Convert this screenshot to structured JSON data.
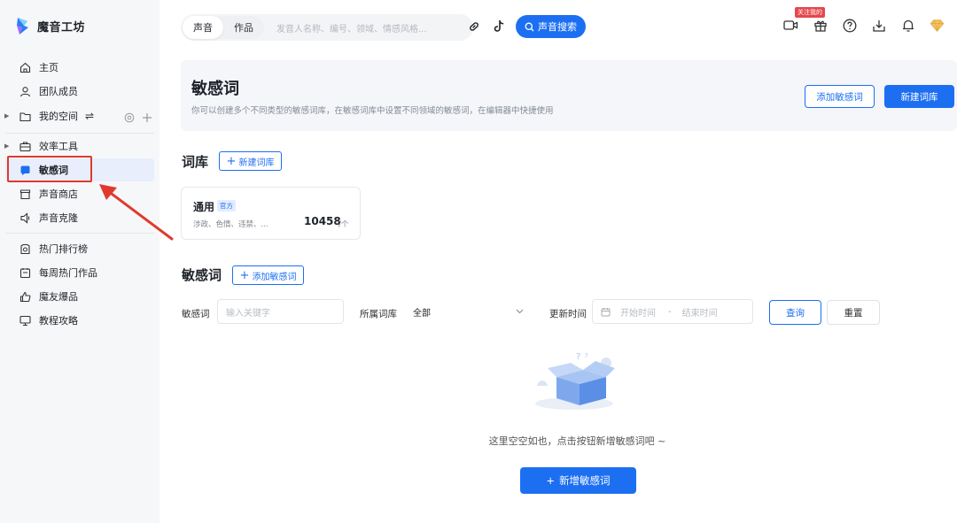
{
  "brand": {
    "name": "魔音工坊"
  },
  "sidebar": {
    "items": [
      {
        "label": "主页",
        "icon": "home-icon"
      },
      {
        "label": "团队成员",
        "icon": "user-icon"
      },
      {
        "label": "我的空间",
        "icon": "folder-icon"
      },
      {
        "label": "效率工具",
        "icon": "toolbox-icon"
      },
      {
        "label": "敏感词",
        "icon": "sensitive-word-icon"
      },
      {
        "label": "声音商店",
        "icon": "store-icon"
      },
      {
        "label": "声音克隆",
        "icon": "clone-icon"
      },
      {
        "label": "热门排行榜",
        "icon": "ranking-icon"
      },
      {
        "label": "每周热门作品",
        "icon": "calendar-icon"
      },
      {
        "label": "魔友爆品",
        "icon": "thumb-up-icon"
      },
      {
        "label": "教程攻略",
        "icon": "monitor-icon"
      }
    ],
    "active": "敏感词"
  },
  "topbar": {
    "tabs": [
      "声音",
      "作品"
    ],
    "search_placeholder": "发音人名称、编号、领域、情感风格...",
    "search_button": "声音搜索",
    "follow_tag": "关注我的"
  },
  "header": {
    "title": "敏感词",
    "description": "你可以创建多个不同类型的敏感词库，在敏感词库中设置不同领域的敏感词，在编辑器中快捷使用",
    "add_word_button": "添加敏感词",
    "new_lib_button": "新建词库"
  },
  "library": {
    "section_title": "词库",
    "new_button": "新建词库",
    "cards": [
      {
        "name": "通用",
        "badge": "官方",
        "tags": "涉政、色情、违禁、...",
        "count": "10458",
        "unit": "/个"
      }
    ]
  },
  "words": {
    "section_title": "敏感词",
    "add_button": "添加敏感词",
    "filter": {
      "word_label": "敏感词",
      "word_placeholder": "输入关键字",
      "lib_label": "所属词库",
      "lib_value": "全部",
      "time_label": "更新时间",
      "start_placeholder": "开始时间",
      "end_placeholder": "结束时间",
      "query_button": "查询",
      "reset_button": "重置"
    },
    "empty": {
      "text": "这里空空如也，点击按钮新增敏感词吧 ~",
      "button": "新增敏感词"
    }
  },
  "colors": {
    "accent": "#1d6ff2",
    "annotation": "#e03a2f"
  }
}
